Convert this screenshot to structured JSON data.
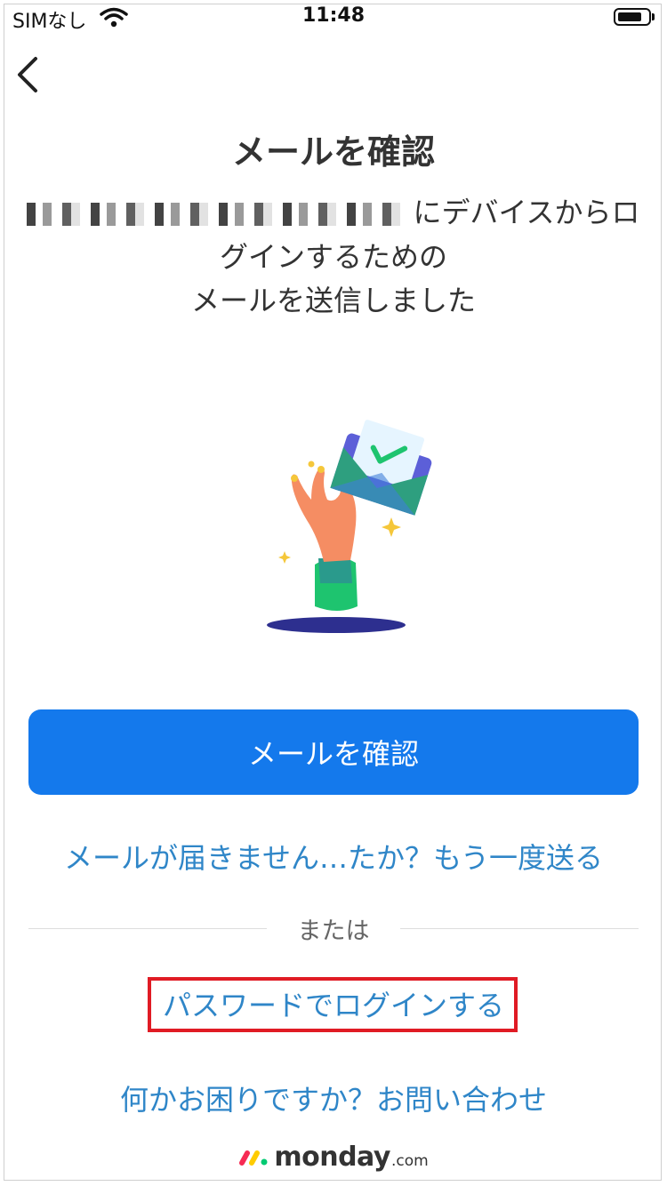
{
  "status_bar": {
    "carrier": "SIMなし",
    "time": "11:48"
  },
  "header": {
    "back_icon": "chevron-left-icon"
  },
  "title": "メールを確認",
  "message": {
    "line1_suffix": "にデバイスからロ",
    "line2": "グインするための",
    "line3": "メールを送信しました"
  },
  "illustration": {
    "icon": "hand-holding-envelope-icon"
  },
  "primary_button": {
    "label": "メールを確認",
    "color": "#1479ec"
  },
  "resend_link": "メールが届きません…たか？もう一度送る",
  "divider": {
    "label": "または"
  },
  "password_login_link": "パスワードでログインする",
  "help_link": "何かお困りですか？お問い合わせ",
  "brand": {
    "name": "monday",
    "suffix": ".com"
  },
  "colors": {
    "link": "#2f86c8",
    "highlight": "#e01b24"
  }
}
